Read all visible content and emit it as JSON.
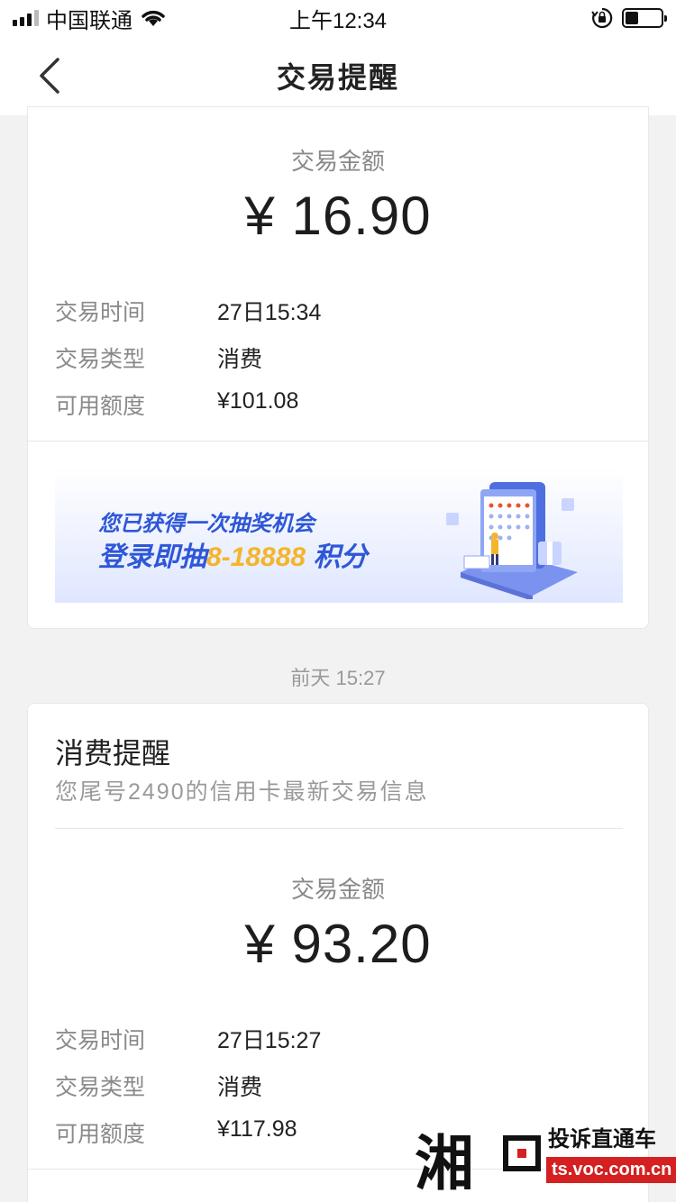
{
  "status_bar": {
    "carrier": "中国联通",
    "time": "上午12:34"
  },
  "nav": {
    "title": "交易提醒"
  },
  "card1": {
    "amount_label": "交易金额",
    "amount": "¥ 16.90",
    "rows": [
      {
        "label": "交易时间",
        "value": "27日15:34"
      },
      {
        "label": "交易类型",
        "value": "消费"
      },
      {
        "label": "可用额度",
        "value": "¥101.08"
      }
    ],
    "banner": {
      "line1": "您已获得一次抽奖机会",
      "line2_prefix": "登录即抽",
      "line2_highlight": "8-18888",
      "line2_suffix": "积分"
    }
  },
  "timestamp": "前天 15:27",
  "card2": {
    "title": "消费提醒",
    "subtitle": "您尾号2490的信用卡最新交易信息",
    "amount_label": "交易金额",
    "amount": "¥ 93.20",
    "rows": [
      {
        "label": "交易时间",
        "value": "27日15:27"
      },
      {
        "label": "交易类型",
        "value": "消费"
      },
      {
        "label": "可用额度",
        "value": "¥117.98"
      }
    ]
  },
  "watermark": {
    "big": "湘",
    "title": "投诉直通车",
    "url": "ts.voc.com.cn"
  },
  "colors": {
    "accent_blue": "#2e57d8",
    "accent_gold": "#f3b52c",
    "watermark_red": "#d42020"
  }
}
